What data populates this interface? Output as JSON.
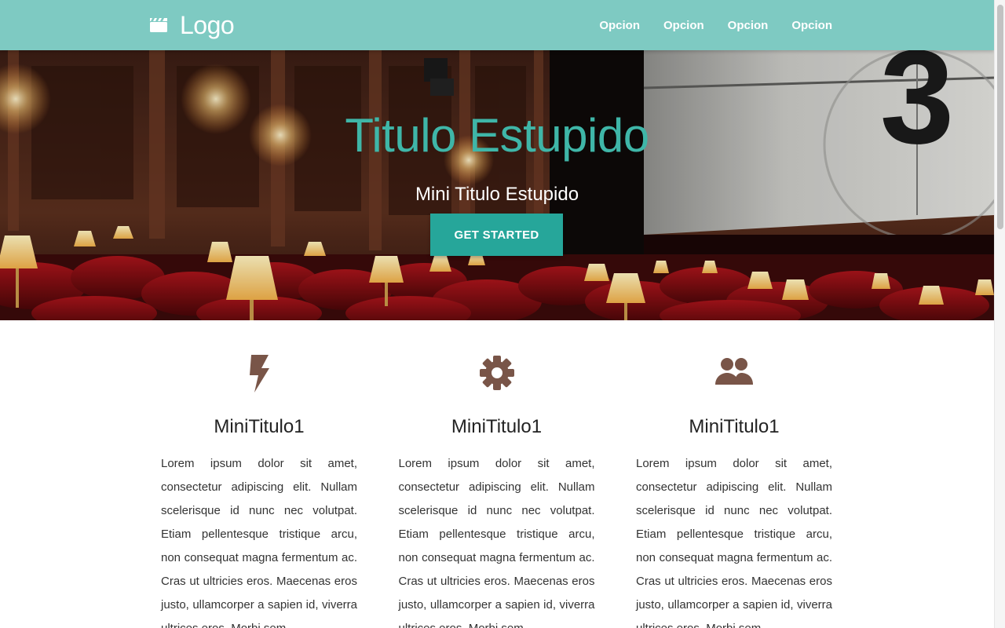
{
  "navbar": {
    "logo_icon": "film-clapper-icon",
    "logo_text": "Logo",
    "links": [
      "Opcion",
      "Opcion",
      "Opcion",
      "Opcion"
    ],
    "background_color": "#7ecac2"
  },
  "hero": {
    "title": "Titulo Estupido",
    "subtitle": "Mini Titulo Estupido",
    "button_label": "GET STARTED",
    "title_color": "#3fb6a8",
    "button_color": "#26a69a",
    "countdown_number": "3"
  },
  "features": [
    {
      "icon": "bolt-icon",
      "title": "MiniTitulo1",
      "text": "Lorem ipsum dolor sit amet, consectetur adipiscing elit. Nullam scelerisque id nunc nec volutpat. Etiam pellentesque tristique arcu, non consequat magna fermentum ac. Cras ut ultricies eros. Maecenas eros justo, ullamcorper a sapien id, viverra ultrices eros. Morbi sem"
    },
    {
      "icon": "gear-icon",
      "title": "MiniTitulo1",
      "text": "Lorem ipsum dolor sit amet, consectetur adipiscing elit. Nullam scelerisque id nunc nec volutpat. Etiam pellentesque tristique arcu, non consequat magna fermentum ac. Cras ut ultricies eros. Maecenas eros justo, ullamcorper a sapien id, viverra ultrices eros. Morbi sem"
    },
    {
      "icon": "group-icon",
      "title": "MiniTitulo1",
      "text": "Lorem ipsum dolor sit amet, consectetur adipiscing elit. Nullam scelerisque id nunc nec volutpat. Etiam pellentesque tristique arcu, non consequat magna fermentum ac. Cras ut ultricies eros. Maecenas eros justo, ullamcorper a sapien id, viverra ultrices eros. Morbi sem"
    }
  ],
  "icon_color": "#795548"
}
